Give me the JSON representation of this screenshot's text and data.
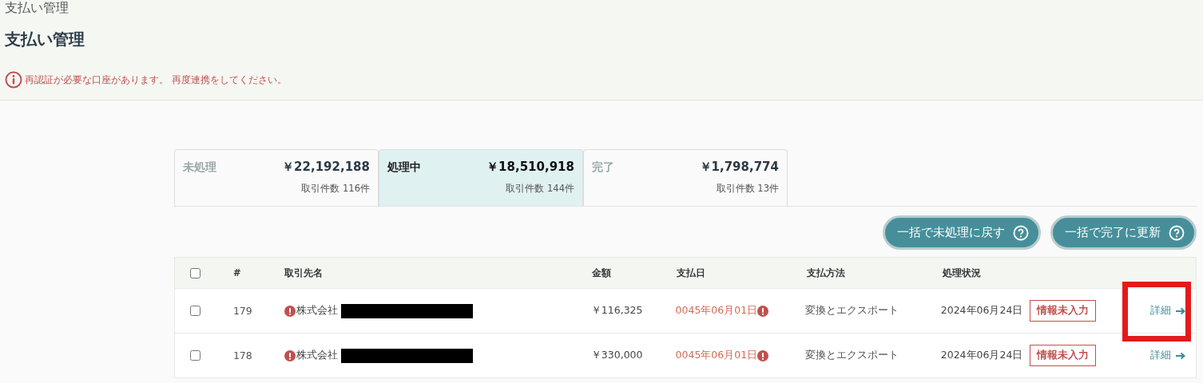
{
  "breadcrumb": "支払い管理",
  "title": "支払い管理",
  "alert": {
    "message": "再認証が必要な口座があります。 再度連携をしてください。"
  },
  "tabs": [
    {
      "label": "未処理",
      "amount": "￥22,192,188",
      "count": "取引件数 116件",
      "selected": false
    },
    {
      "label": "処理中",
      "amount": "￥18,510,918",
      "count": "取引件数 144件",
      "selected": true
    },
    {
      "label": "完了",
      "amount": "￥1,798,774",
      "count": "取引件数 13件",
      "selected": false
    }
  ],
  "buttons": [
    {
      "label": "一括で未処理に戻す"
    },
    {
      "label": "一括で完了に更新"
    }
  ],
  "table": {
    "columns": [
      "#",
      "取引先名",
      "金額",
      "支払日",
      "支払方法",
      "処理状況"
    ],
    "select_all": {
      "checked": false
    },
    "rows": [
      {
        "checked": false,
        "number": "179",
        "vendor": "株式会社",
        "vendor_warning": true,
        "redacted": true,
        "amount": "￥116,325",
        "date": "0045年06月01日",
        "date_warning": true,
        "method": "変換とエクスポート",
        "processed": "2024年06月24日",
        "badge": "情報未入力",
        "link": "詳細",
        "highlighted": true
      },
      {
        "checked": false,
        "number": "178",
        "vendor": "株式会社",
        "vendor_warning": true,
        "redacted": true,
        "amount": "￥330,000",
        "date": "0045年06月01日",
        "date_warning": true,
        "method": "変換とエクスポート",
        "processed": "2024年06月24日",
        "badge": "情報未入力",
        "link": "詳細",
        "highlighted": false
      }
    ]
  }
}
